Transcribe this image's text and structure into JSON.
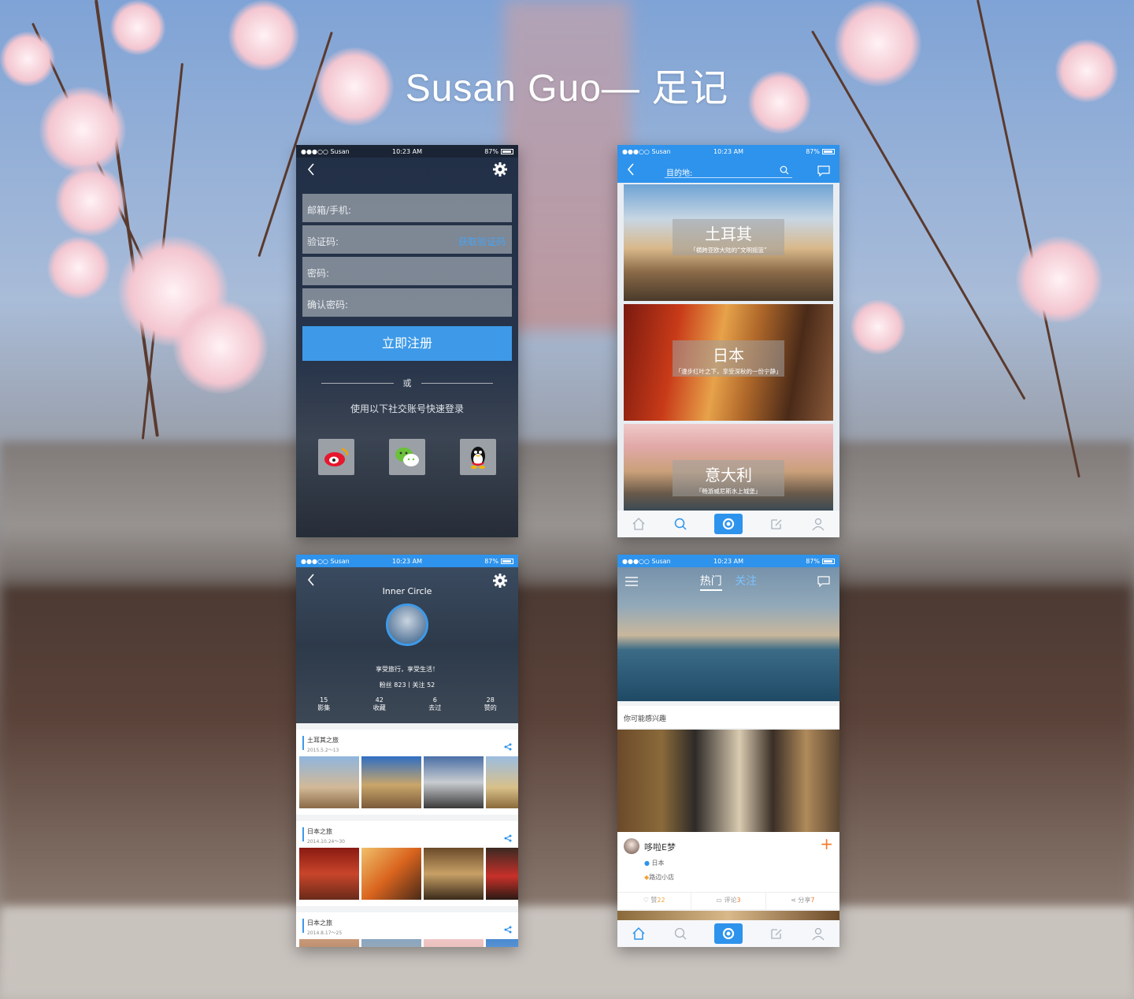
{
  "header": {
    "title": "Susan Guo— 足记"
  },
  "statusbar": {
    "carrier": "●●●○○ Susan",
    "time": "10:23 AM",
    "battery": "87%"
  },
  "register": {
    "fields": [
      {
        "label": "邮箱/手机:"
      },
      {
        "label": "验证码:",
        "link": "获取验证码"
      },
      {
        "label": "密码:"
      },
      {
        "label": "确认密码:"
      }
    ],
    "submit_label": "立即注册",
    "or_label": "或",
    "social_hint": "使用以下社交账号快速登录",
    "social": [
      "weibo-icon",
      "wechat-icon",
      "qq-icon"
    ]
  },
  "destination": {
    "search_label": "目的地:",
    "cards": [
      {
        "title": "土耳其",
        "subtitle": "「横跨亚欧大陆的“文明摇篮”"
      },
      {
        "title": "日本",
        "subtitle": "「漫步红叶之下，享受深秋的一份宁静」"
      },
      {
        "title": "意大利",
        "subtitle": "「畅游威尼斯水上城堡」"
      }
    ]
  },
  "tabbar": {
    "items": [
      "home-icon",
      "search-icon",
      "camera-icon",
      "edit-icon",
      "profile-icon"
    ]
  },
  "profile": {
    "name": "Inner Circle",
    "motto": "享受旅行，享受生活！",
    "fans": "粉丝 823丨关注 52",
    "stats": [
      {
        "value": "15",
        "label": "影集"
      },
      {
        "value": "42",
        "label": "收藏"
      },
      {
        "value": "6",
        "label": "去过"
      },
      {
        "value": "28",
        "label": "赞的"
      }
    ],
    "albums": [
      {
        "title": "土耳其之旅",
        "date": "2015.5.2～13"
      },
      {
        "title": "日本之旅",
        "date": "2014.10.24～30"
      },
      {
        "title": "日本之旅",
        "date": "2014.8.17～25"
      }
    ]
  },
  "feed": {
    "tabs": [
      "热门",
      "关注"
    ],
    "section_label": "你可能感兴趣",
    "post": {
      "user": "哆啦E梦",
      "location": "日本",
      "tag": "路边小店",
      "actions": [
        {
          "label": "赞",
          "count": "22"
        },
        {
          "label": "评论",
          "count": "3"
        },
        {
          "label": "分享",
          "count": "7"
        }
      ]
    }
  },
  "colors": {
    "accent": "#2e93ec",
    "orange": "#f47a2a"
  }
}
